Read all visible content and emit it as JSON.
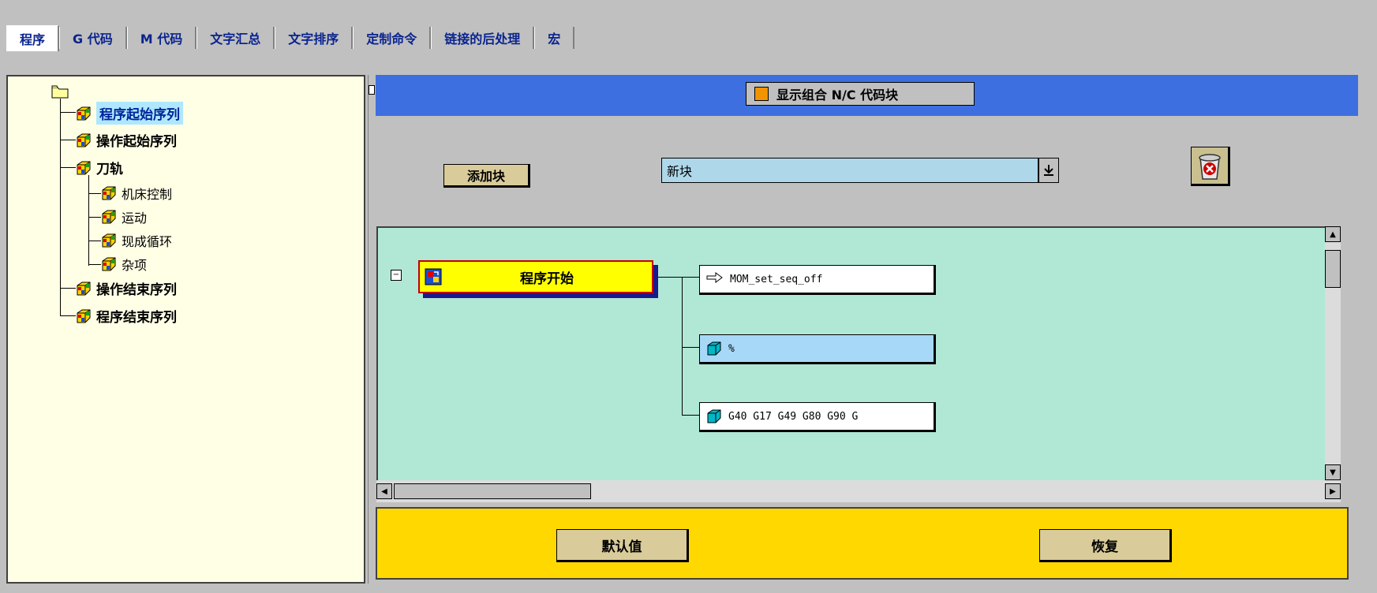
{
  "tabs": [
    {
      "label": "程序",
      "active": true
    },
    {
      "label": "G 代码"
    },
    {
      "label": "M 代码"
    },
    {
      "label": "文字汇总"
    },
    {
      "label": "文字排序"
    },
    {
      "label": "定制命令"
    },
    {
      "label": "链接的后处理"
    },
    {
      "label": "宏"
    }
  ],
  "tree": {
    "items": [
      {
        "label": "程序起始序列",
        "selected": true
      },
      {
        "label": "操作起始序列"
      },
      {
        "label": "刀轨"
      },
      {
        "label": "机床控制"
      },
      {
        "label": "运动"
      },
      {
        "label": "现成循环"
      },
      {
        "label": "杂项"
      },
      {
        "label": "操作结束序列"
      },
      {
        "label": "程序结束序列"
      }
    ]
  },
  "header": {
    "combo_label": "显示组合 N/C 代码块",
    "combo_checked": true
  },
  "toolbar": {
    "add_block": "添加块",
    "new_block_value": "新块",
    "dropdown_icon": "download-arrow-icon",
    "trash_icon": "trash-icon"
  },
  "diagram": {
    "start_label": "程序开始",
    "commands": [
      {
        "text": "MOM_set_seq_off",
        "icon": "hand-pointer-icon"
      },
      {
        "text": "%",
        "icon": "cube-icon"
      },
      {
        "text": "G40 G17 G49 G80 G90 G",
        "icon": "cube-icon"
      }
    ]
  },
  "bottom": {
    "default_button": "默认值",
    "restore_button": "恢复"
  },
  "colors": {
    "accent_blue": "#3d6fe0",
    "diagram_bg": "#b0e8d5",
    "bottom_bg": "#ffd800",
    "tree_bg": "#ffffe6"
  }
}
